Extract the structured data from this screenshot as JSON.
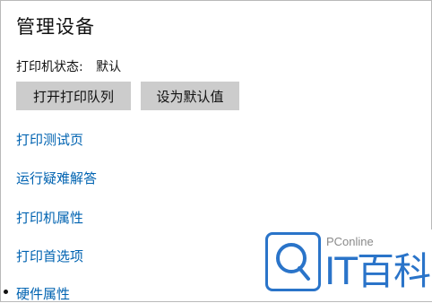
{
  "page": {
    "title": "管理设备"
  },
  "status": {
    "label": "打印机状态:",
    "value": "默认"
  },
  "buttons": {
    "open_queue": "打开打印队列",
    "set_default": "设为默认值"
  },
  "links": [
    {
      "label": "打印测试页"
    },
    {
      "label": "运行疑难解答"
    },
    {
      "label": "打印机属性"
    },
    {
      "label": "打印首选项"
    },
    {
      "label": "硬件属性"
    }
  ],
  "watermark": {
    "brand": "PConline",
    "text": "IT百科"
  },
  "colors": {
    "link": "#0063b1",
    "button_bg": "#cccccc",
    "watermark_blue": "#2a74c9"
  }
}
